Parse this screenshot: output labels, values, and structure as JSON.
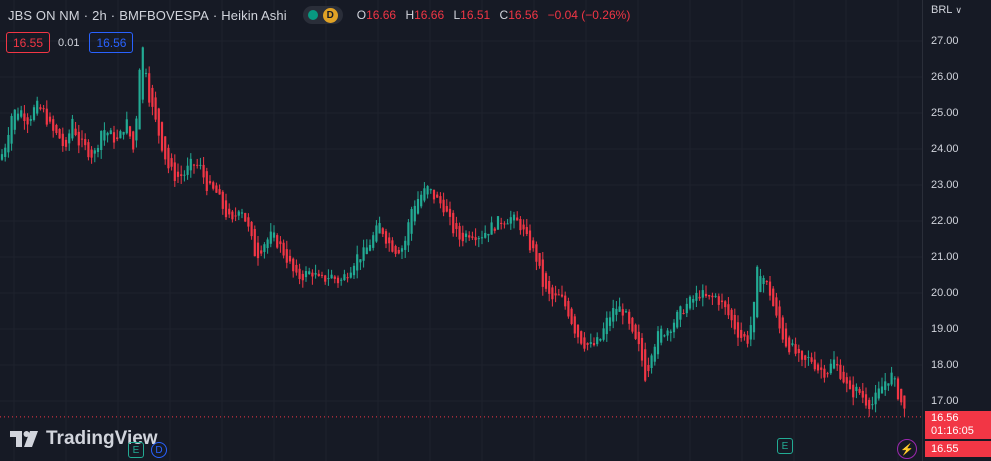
{
  "header": {
    "symbol": "JBS ON NM",
    "interval": "2h",
    "exchange": "BMFBOVESPA",
    "chart_style": "Heikin Ashi",
    "separator": "·",
    "status_badge": "D",
    "ohlc": {
      "o_label": "O",
      "o": "16.66",
      "h_label": "H",
      "h": "16.66",
      "l_label": "L",
      "l": "16.51",
      "c_label": "C",
      "c": "16.56",
      "change": "−0.04 (−0.26%)"
    }
  },
  "trade": {
    "sell": "16.55",
    "spread": "0.01",
    "buy": "16.56"
  },
  "currency": "BRL",
  "price_labels": {
    "last": "16.56",
    "countdown": "01:16:05",
    "bid": "16.55"
  },
  "brand": "TradingView",
  "events": {
    "earnings_label": "E",
    "dividend_label": "D",
    "flash_icon": "lightning-icon"
  },
  "colors": {
    "up": "#22ab94",
    "down": "#f23645",
    "background": "#161a25",
    "grid": "#1f2430"
  },
  "chart_data": {
    "type": "candlestick",
    "style": "heikin-ashi",
    "y_axis_ticks": [
      "27.00",
      "26.00",
      "25.00",
      "24.00",
      "23.00",
      "22.00",
      "21.00",
      "20.00",
      "19.00",
      "18.00",
      "17.00"
    ],
    "ylim": [
      16.4,
      27.4
    ],
    "grid": true,
    "close_path": [
      [
        0,
        23.7
      ],
      [
        5,
        24.1
      ],
      [
        12,
        25.0
      ],
      [
        20,
        25.1
      ],
      [
        28,
        24.8
      ],
      [
        36,
        25.2
      ],
      [
        44,
        25.0
      ],
      [
        52,
        24.5
      ],
      [
        60,
        24.3
      ],
      [
        66,
        23.9
      ],
      [
        72,
        24.9
      ],
      [
        78,
        24.2
      ],
      [
        86,
        24.0
      ],
      [
        94,
        23.8
      ],
      [
        102,
        24.6
      ],
      [
        110,
        24.4
      ],
      [
        118,
        24.2
      ],
      [
        126,
        24.8
      ],
      [
        134,
        23.9
      ],
      [
        140,
        26.5
      ],
      [
        144,
        26.9
      ],
      [
        148,
        25.6
      ],
      [
        154,
        24.9
      ],
      [
        160,
        24.3
      ],
      [
        168,
        23.5
      ],
      [
        176,
        23.2
      ],
      [
        184,
        23.3
      ],
      [
        192,
        23.6
      ],
      [
        200,
        23.5
      ],
      [
        208,
        22.9
      ],
      [
        216,
        22.8
      ],
      [
        224,
        22.3
      ],
      [
        232,
        21.9
      ],
      [
        240,
        22.5
      ],
      [
        248,
        21.8
      ],
      [
        256,
        21.0
      ],
      [
        264,
        21.4
      ],
      [
        272,
        21.6
      ],
      [
        280,
        21.3
      ],
      [
        288,
        20.9
      ],
      [
        296,
        20.4
      ],
      [
        304,
        20.5
      ],
      [
        312,
        20.6
      ],
      [
        320,
        20.3
      ],
      [
        330,
        20.5
      ],
      [
        340,
        20.3
      ],
      [
        348,
        20.6
      ],
      [
        356,
        21.0
      ],
      [
        364,
        21.1
      ],
      [
        372,
        21.5
      ],
      [
        380,
        21.9
      ],
      [
        388,
        21.4
      ],
      [
        396,
        21.2
      ],
      [
        404,
        21.3
      ],
      [
        412,
        22.4
      ],
      [
        420,
        22.7
      ],
      [
        428,
        22.9
      ],
      [
        436,
        22.6
      ],
      [
        444,
        22.4
      ],
      [
        452,
        21.8
      ],
      [
        460,
        21.5
      ],
      [
        470,
        21.7
      ],
      [
        480,
        21.6
      ],
      [
        490,
        21.8
      ],
      [
        500,
        22.0
      ],
      [
        510,
        22.1
      ],
      [
        520,
        21.9
      ],
      [
        528,
        21.4
      ],
      [
        536,
        21.0
      ],
      [
        544,
        20.1
      ],
      [
        552,
        19.8
      ],
      [
        560,
        19.9
      ],
      [
        568,
        19.5
      ],
      [
        576,
        18.9
      ],
      [
        584,
        18.6
      ],
      [
        592,
        18.5
      ],
      [
        600,
        18.7
      ],
      [
        608,
        19.3
      ],
      [
        616,
        19.6
      ],
      [
        624,
        19.5
      ],
      [
        632,
        18.8
      ],
      [
        640,
        18.4
      ],
      [
        646,
        17.6
      ],
      [
        652,
        18.5
      ],
      [
        660,
        18.9
      ],
      [
        668,
        19.0
      ],
      [
        676,
        19.3
      ],
      [
        684,
        19.6
      ],
      [
        692,
        19.8
      ],
      [
        700,
        20.0
      ],
      [
        708,
        19.8
      ],
      [
        716,
        19.9
      ],
      [
        724,
        19.6
      ],
      [
        732,
        19.2
      ],
      [
        740,
        18.8
      ],
      [
        748,
        18.7
      ],
      [
        754,
        19.6
      ],
      [
        758,
        20.8
      ],
      [
        764,
        20.4
      ],
      [
        770,
        20.0
      ],
      [
        778,
        19.1
      ],
      [
        786,
        18.6
      ],
      [
        794,
        18.4
      ],
      [
        802,
        18.0
      ],
      [
        810,
        18.2
      ],
      [
        818,
        17.9
      ],
      [
        826,
        17.8
      ],
      [
        834,
        18.1
      ],
      [
        842,
        17.7
      ],
      [
        850,
        17.2
      ],
      [
        858,
        17.3
      ],
      [
        866,
        17.0
      ],
      [
        872,
        16.9
      ],
      [
        878,
        17.2
      ],
      [
        886,
        17.6
      ],
      [
        892,
        17.7
      ],
      [
        898,
        17.2
      ],
      [
        906,
        16.6
      ]
    ]
  }
}
